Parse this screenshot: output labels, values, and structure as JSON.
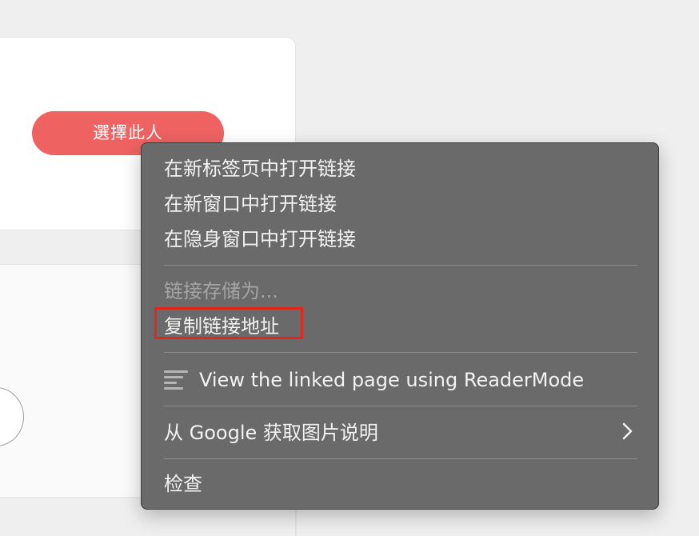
{
  "background": {
    "select_button_label": "選擇此人",
    "accent_color": "#ef6262"
  },
  "context_menu": {
    "items": [
      {
        "label": "在新标签页中打开链接",
        "enabled": true
      },
      {
        "label": "在新窗口中打开链接",
        "enabled": true
      },
      {
        "label": "在隐身窗口中打开链接",
        "enabled": true
      },
      {
        "label": "链接存储为...",
        "enabled": false
      },
      {
        "label": "复制链接地址",
        "enabled": true,
        "highlighted": true
      },
      {
        "label": "View the linked page using ReaderMode",
        "enabled": true,
        "icon": "reader-mode-icon"
      },
      {
        "label": "从 Google 获取图片说明",
        "enabled": true,
        "submenu": true,
        "icon": "chevron-right-icon"
      },
      {
        "label": "检查",
        "enabled": true
      }
    ],
    "highlight_color": "#e1261c"
  }
}
